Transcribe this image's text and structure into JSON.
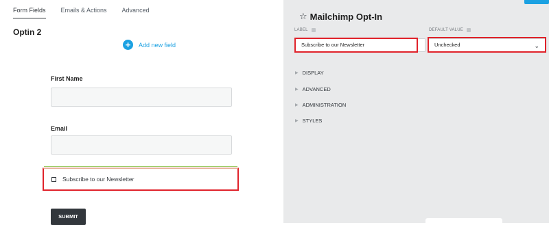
{
  "tabs": [
    "Form Fields",
    "Emails & Actions",
    "Advanced"
  ],
  "form_title": "Optin 2",
  "add_field_label": "Add new field",
  "fields": {
    "first_name_label": "First Name",
    "email_label": "Email",
    "newsletter_label": "Subscribe to our Newsletter",
    "submit_label": "SUBMIT"
  },
  "panel": {
    "title": "Mailchimp Opt-In",
    "label_caption": "LABEL",
    "label_value": "Subscribe to our Newsletter",
    "default_caption": "DEFAULT VALUE",
    "default_value": "Unchecked",
    "sections": [
      "DISPLAY",
      "ADVANCED",
      "ADMINISTRATION",
      "STYLES"
    ]
  },
  "colors": {
    "accent": "#1ba1e2",
    "highlight": "#e0222a",
    "panel_bg": "#e9eaeb"
  }
}
